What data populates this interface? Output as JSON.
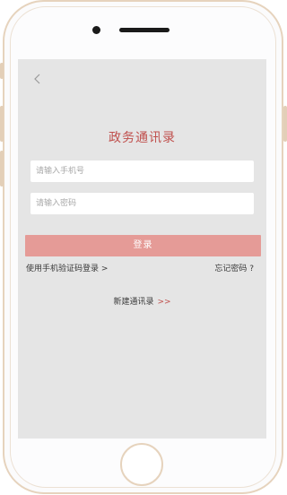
{
  "app": {
    "title": "政务通讯录"
  },
  "form": {
    "phone_placeholder": "请输入手机号",
    "password_placeholder": "请输入密码",
    "login_label": "登录"
  },
  "links": {
    "sms_login": "使用手机验证码登录 >",
    "forgot_password": "忘记密码 ?",
    "new_directory": "新建通讯录",
    "new_directory_arrow": ">>"
  },
  "colors": {
    "accent": "#c0504d",
    "login_button": "#e59b97",
    "screen_bg": "#e5e5e5",
    "phone_frame": "#e6d3bd"
  },
  "icons": {
    "back": "chevron-left-icon"
  }
}
